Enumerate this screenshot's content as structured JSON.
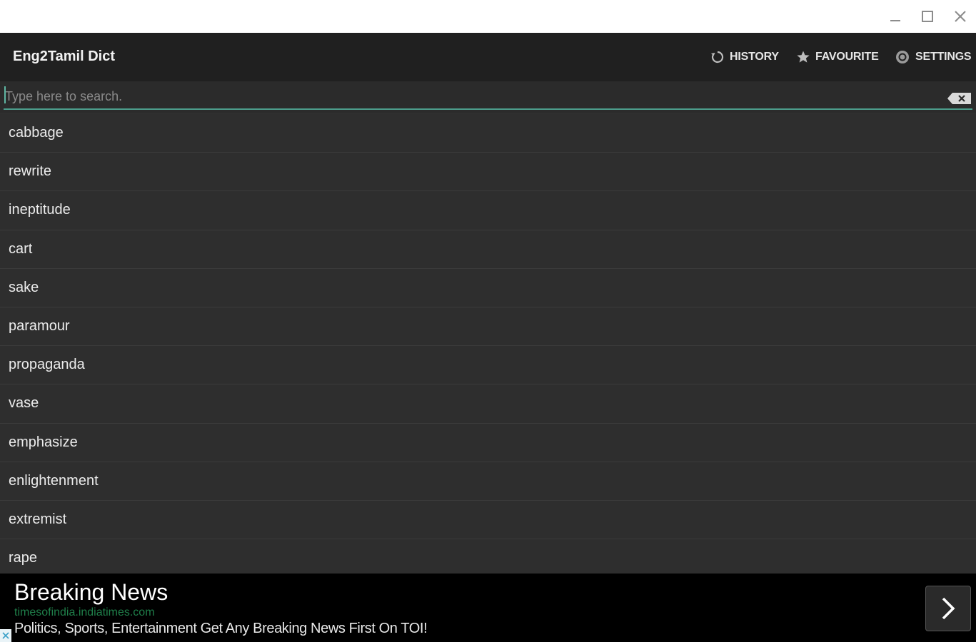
{
  "window": {
    "controls": [
      "minimize-icon",
      "maximize-icon",
      "close-icon"
    ]
  },
  "appbar": {
    "title": "Eng2Tamil Dict",
    "actions": [
      {
        "label": "HISTORY",
        "icon": "history-icon"
      },
      {
        "label": "FAVOURITE",
        "icon": "star-icon"
      },
      {
        "label": "SETTINGS",
        "icon": "gear-icon"
      }
    ]
  },
  "search": {
    "value": "",
    "placeholder": "Type here to search.",
    "accent_color": "#4c9d8b"
  },
  "words": [
    "cabbage",
    "rewrite",
    "ineptitude",
    "cart",
    "sake",
    "paramour",
    "propaganda",
    "vase",
    "emphasize",
    "enlightenment",
    "extremist",
    "rape"
  ],
  "ad": {
    "title": "Breaking News",
    "url": "timesofindia.indiatimes.com",
    "description": "Politics, Sports, Entertainment Get Any Breaking News First On TOI!",
    "url_color": "#1f7f4a"
  }
}
